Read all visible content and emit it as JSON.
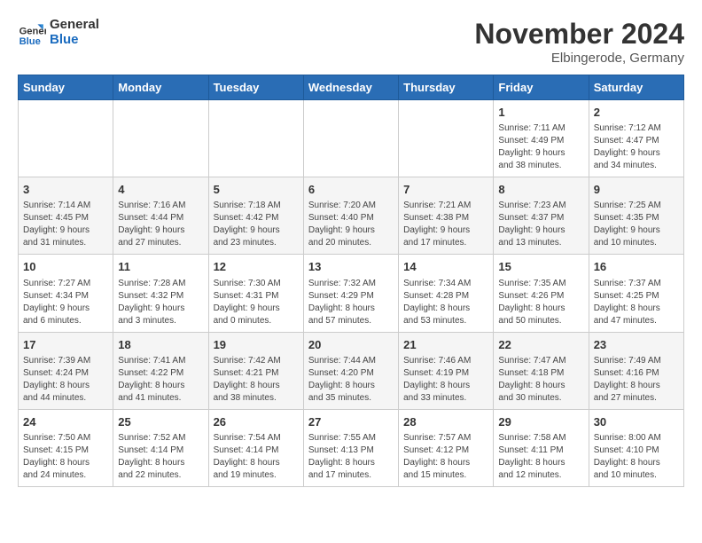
{
  "logo": {
    "line1": "General",
    "line2": "Blue"
  },
  "title": "November 2024",
  "location": "Elbingerode, Germany",
  "days_of_week": [
    "Sunday",
    "Monday",
    "Tuesday",
    "Wednesday",
    "Thursday",
    "Friday",
    "Saturday"
  ],
  "weeks": [
    [
      {
        "day": "",
        "info": ""
      },
      {
        "day": "",
        "info": ""
      },
      {
        "day": "",
        "info": ""
      },
      {
        "day": "",
        "info": ""
      },
      {
        "day": "",
        "info": ""
      },
      {
        "day": "1",
        "info": "Sunrise: 7:11 AM\nSunset: 4:49 PM\nDaylight: 9 hours\nand 38 minutes."
      },
      {
        "day": "2",
        "info": "Sunrise: 7:12 AM\nSunset: 4:47 PM\nDaylight: 9 hours\nand 34 minutes."
      }
    ],
    [
      {
        "day": "3",
        "info": "Sunrise: 7:14 AM\nSunset: 4:45 PM\nDaylight: 9 hours\nand 31 minutes."
      },
      {
        "day": "4",
        "info": "Sunrise: 7:16 AM\nSunset: 4:44 PM\nDaylight: 9 hours\nand 27 minutes."
      },
      {
        "day": "5",
        "info": "Sunrise: 7:18 AM\nSunset: 4:42 PM\nDaylight: 9 hours\nand 23 minutes."
      },
      {
        "day": "6",
        "info": "Sunrise: 7:20 AM\nSunset: 4:40 PM\nDaylight: 9 hours\nand 20 minutes."
      },
      {
        "day": "7",
        "info": "Sunrise: 7:21 AM\nSunset: 4:38 PM\nDaylight: 9 hours\nand 17 minutes."
      },
      {
        "day": "8",
        "info": "Sunrise: 7:23 AM\nSunset: 4:37 PM\nDaylight: 9 hours\nand 13 minutes."
      },
      {
        "day": "9",
        "info": "Sunrise: 7:25 AM\nSunset: 4:35 PM\nDaylight: 9 hours\nand 10 minutes."
      }
    ],
    [
      {
        "day": "10",
        "info": "Sunrise: 7:27 AM\nSunset: 4:34 PM\nDaylight: 9 hours\nand 6 minutes."
      },
      {
        "day": "11",
        "info": "Sunrise: 7:28 AM\nSunset: 4:32 PM\nDaylight: 9 hours\nand 3 minutes."
      },
      {
        "day": "12",
        "info": "Sunrise: 7:30 AM\nSunset: 4:31 PM\nDaylight: 9 hours\nand 0 minutes."
      },
      {
        "day": "13",
        "info": "Sunrise: 7:32 AM\nSunset: 4:29 PM\nDaylight: 8 hours\nand 57 minutes."
      },
      {
        "day": "14",
        "info": "Sunrise: 7:34 AM\nSunset: 4:28 PM\nDaylight: 8 hours\nand 53 minutes."
      },
      {
        "day": "15",
        "info": "Sunrise: 7:35 AM\nSunset: 4:26 PM\nDaylight: 8 hours\nand 50 minutes."
      },
      {
        "day": "16",
        "info": "Sunrise: 7:37 AM\nSunset: 4:25 PM\nDaylight: 8 hours\nand 47 minutes."
      }
    ],
    [
      {
        "day": "17",
        "info": "Sunrise: 7:39 AM\nSunset: 4:24 PM\nDaylight: 8 hours\nand 44 minutes."
      },
      {
        "day": "18",
        "info": "Sunrise: 7:41 AM\nSunset: 4:22 PM\nDaylight: 8 hours\nand 41 minutes."
      },
      {
        "day": "19",
        "info": "Sunrise: 7:42 AM\nSunset: 4:21 PM\nDaylight: 8 hours\nand 38 minutes."
      },
      {
        "day": "20",
        "info": "Sunrise: 7:44 AM\nSunset: 4:20 PM\nDaylight: 8 hours\nand 35 minutes."
      },
      {
        "day": "21",
        "info": "Sunrise: 7:46 AM\nSunset: 4:19 PM\nDaylight: 8 hours\nand 33 minutes."
      },
      {
        "day": "22",
        "info": "Sunrise: 7:47 AM\nSunset: 4:18 PM\nDaylight: 8 hours\nand 30 minutes."
      },
      {
        "day": "23",
        "info": "Sunrise: 7:49 AM\nSunset: 4:16 PM\nDaylight: 8 hours\nand 27 minutes."
      }
    ],
    [
      {
        "day": "24",
        "info": "Sunrise: 7:50 AM\nSunset: 4:15 PM\nDaylight: 8 hours\nand 24 minutes."
      },
      {
        "day": "25",
        "info": "Sunrise: 7:52 AM\nSunset: 4:14 PM\nDaylight: 8 hours\nand 22 minutes."
      },
      {
        "day": "26",
        "info": "Sunrise: 7:54 AM\nSunset: 4:14 PM\nDaylight: 8 hours\nand 19 minutes."
      },
      {
        "day": "27",
        "info": "Sunrise: 7:55 AM\nSunset: 4:13 PM\nDaylight: 8 hours\nand 17 minutes."
      },
      {
        "day": "28",
        "info": "Sunrise: 7:57 AM\nSunset: 4:12 PM\nDaylight: 8 hours\nand 15 minutes."
      },
      {
        "day": "29",
        "info": "Sunrise: 7:58 AM\nSunset: 4:11 PM\nDaylight: 8 hours\nand 12 minutes."
      },
      {
        "day": "30",
        "info": "Sunrise: 8:00 AM\nSunset: 4:10 PM\nDaylight: 8 hours\nand 10 minutes."
      }
    ]
  ]
}
